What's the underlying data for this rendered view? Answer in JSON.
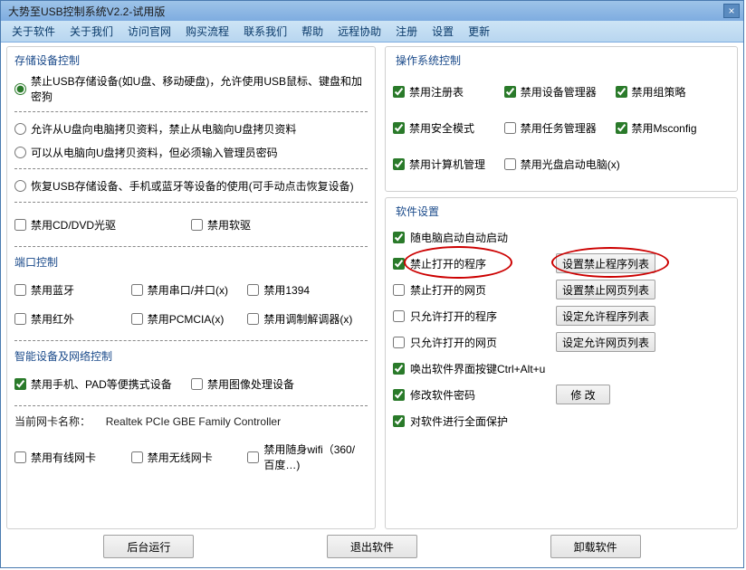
{
  "window": {
    "title": "大势至USB控制系统V2.2-试用版"
  },
  "menu": [
    "关于软件",
    "关于我们",
    "访问官网",
    "购买流程",
    "联系我们",
    "帮助",
    "远程协助",
    "注册",
    "设置",
    "更新"
  ],
  "left": {
    "storage": {
      "title": "存储设备控制",
      "r1": "禁止USB存储设备(如U盘、移动硬盘)，允许使用USB鼠标、键盘和加密狗",
      "r2": "允许从U盘向电脑拷贝资料，禁止从电脑向U盘拷贝资料",
      "r3": "可以从电脑向U盘拷贝资料，但必须输入管理员密码",
      "r4": "恢复USB存储设备、手机或蓝牙等设备的使用(可手动点击恢复设备)"
    },
    "cddvd": {
      "c1": "禁用CD/DVD光驱",
      "c2": "禁用软驱"
    },
    "port": {
      "title": "端口控制",
      "c1": "禁用蓝牙",
      "c2": "禁用串口/并口(x)",
      "c3": "禁用1394",
      "c4": "禁用红外",
      "c5": "禁用PCMCIA(x)",
      "c6": "禁用调制解调器(x)"
    },
    "smart": {
      "title": "智能设备及网络控制",
      "c1": "禁用手机、PAD等便携式设备",
      "c2": "禁用图像处理设备"
    },
    "nic": {
      "label": "当前网卡名称：",
      "name": "Realtek PCIe GBE Family Controller",
      "c1": "禁用有线网卡",
      "c2": "禁用无线网卡",
      "c3": "禁用随身wifi（360/百度…)"
    }
  },
  "right": {
    "os": {
      "title": "操作系统控制",
      "c1": "禁用注册表",
      "c2": "禁用设备管理器",
      "c3": "禁用组策略",
      "c4": "禁用安全模式",
      "c5": "禁用任务管理器",
      "c6": "禁用Msconfig",
      "c7": "禁用计算机管理",
      "c8": "禁用光盘启动电脑(x)"
    },
    "sw": {
      "title": "软件设置",
      "r1": "随电脑启动自动启动",
      "r2": "禁止打开的程序",
      "b2": "设置禁止程序列表",
      "r3": "禁止打开的网页",
      "b3": "设置禁止网页列表",
      "r4": "只允许打开的程序",
      "b4": "设定允许程序列表",
      "r5": "只允许打开的网页",
      "b5": "设定允许网页列表",
      "r6": "唤出软件界面按键Ctrl+Alt+u",
      "r7": "修改软件密码",
      "b7": "修 改",
      "r8": "对软件进行全面保护"
    }
  },
  "bottom": {
    "b1": "后台运行",
    "b2": "退出软件",
    "b3": "卸载软件"
  }
}
